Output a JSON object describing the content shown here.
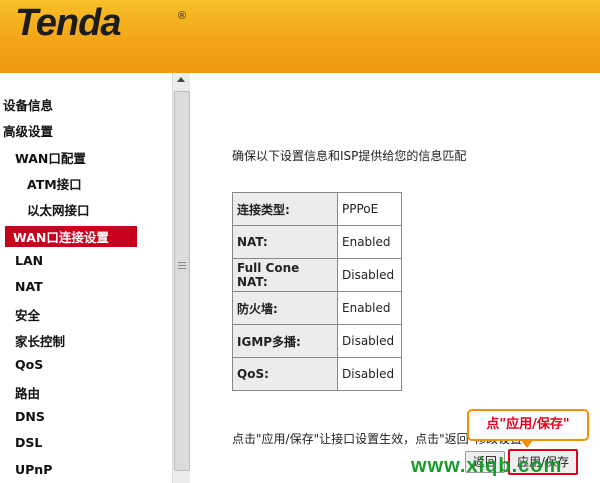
{
  "brand": {
    "logo": "Tenda",
    "registered": "®"
  },
  "sidebar": {
    "items": [
      {
        "label": "设备信息",
        "level": 0
      },
      {
        "label": "高级设置",
        "level": 0
      },
      {
        "label": "WAN口配置",
        "level": 1
      },
      {
        "label": "ATM接口",
        "level": 2
      },
      {
        "label": "以太网接口",
        "level": 2
      },
      {
        "label": "WAN口连接设置",
        "level": 1,
        "active": true
      },
      {
        "label": "LAN",
        "level": 1
      },
      {
        "label": "NAT",
        "level": 1
      },
      {
        "label": "安全",
        "level": 1
      },
      {
        "label": "家长控制",
        "level": 1
      },
      {
        "label": "QoS",
        "level": 1
      },
      {
        "label": "路由",
        "level": 1
      },
      {
        "label": "DNS",
        "level": 1
      },
      {
        "label": "DSL",
        "level": 1
      },
      {
        "label": "UPnP",
        "level": 1
      }
    ]
  },
  "main": {
    "intro": "确保以下设置信息和ISP提供给您的信息匹配",
    "rows": [
      {
        "key": "连接类型:",
        "value": "PPPoE"
      },
      {
        "key": "NAT:",
        "value": "Enabled"
      },
      {
        "key": "Full Cone NAT:",
        "value": "Disabled"
      },
      {
        "key": "防火墙:",
        "value": "Enabled"
      },
      {
        "key": "IGMP多播:",
        "value": "Disabled"
      },
      {
        "key": "QoS:",
        "value": "Disabled"
      }
    ],
    "note": "点击\"应用/保存\"让接口设置生效，点击\"返回\"修改设置",
    "back_label": "返回",
    "apply_label": "应用/保存"
  },
  "callout": {
    "text": "点\"应用/保存\""
  },
  "watermark": "www.xiqb.com",
  "colors": {
    "header": "#f3a417",
    "active": "#c8001e",
    "callout_border": "#f39200",
    "watermark": "#159d2a"
  }
}
